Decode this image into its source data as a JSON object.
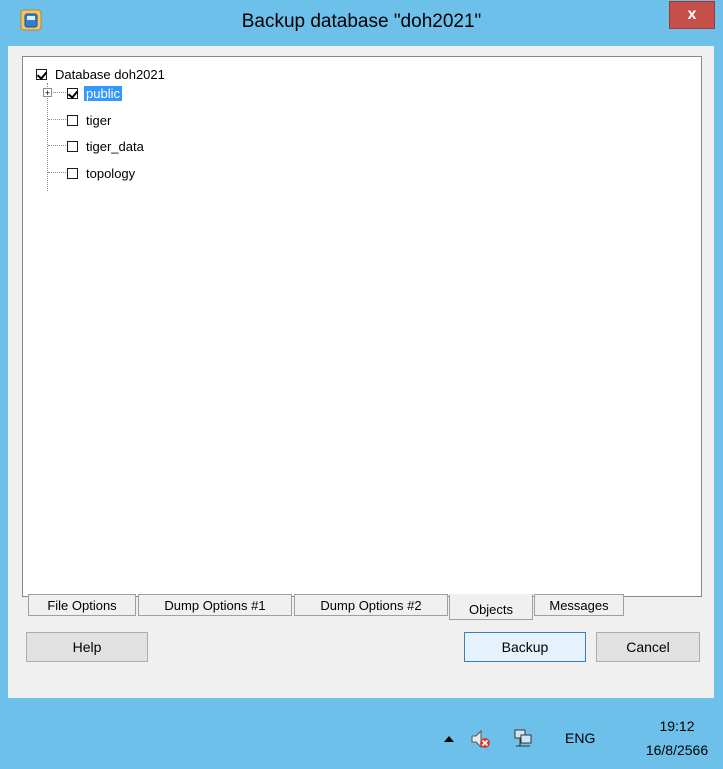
{
  "window": {
    "title": "Backup database \"doh2021\"",
    "close_label": "x"
  },
  "tree": {
    "root": {
      "label": "Database doh2021",
      "checked": true
    },
    "items": [
      {
        "label": "public",
        "checked": true,
        "selected": true,
        "expandable": true
      },
      {
        "label": "tiger",
        "checked": false
      },
      {
        "label": "tiger_data",
        "checked": false
      },
      {
        "label": "topology",
        "checked": false
      }
    ]
  },
  "tabs": [
    {
      "label": "File Options",
      "active": false
    },
    {
      "label": "Dump Options #1",
      "active": false
    },
    {
      "label": "Dump Options #2",
      "active": false
    },
    {
      "label": "Objects",
      "active": true
    },
    {
      "label": "Messages",
      "active": false
    }
  ],
  "buttons": {
    "help": "Help",
    "backup": "Backup",
    "cancel": "Cancel"
  },
  "taskbar": {
    "language": "ENG",
    "time": "19:12",
    "date": "16/8/2566"
  },
  "colors": {
    "selection": "#3399ff",
    "frame": "#6cc0ea",
    "close": "#c74f4a"
  }
}
